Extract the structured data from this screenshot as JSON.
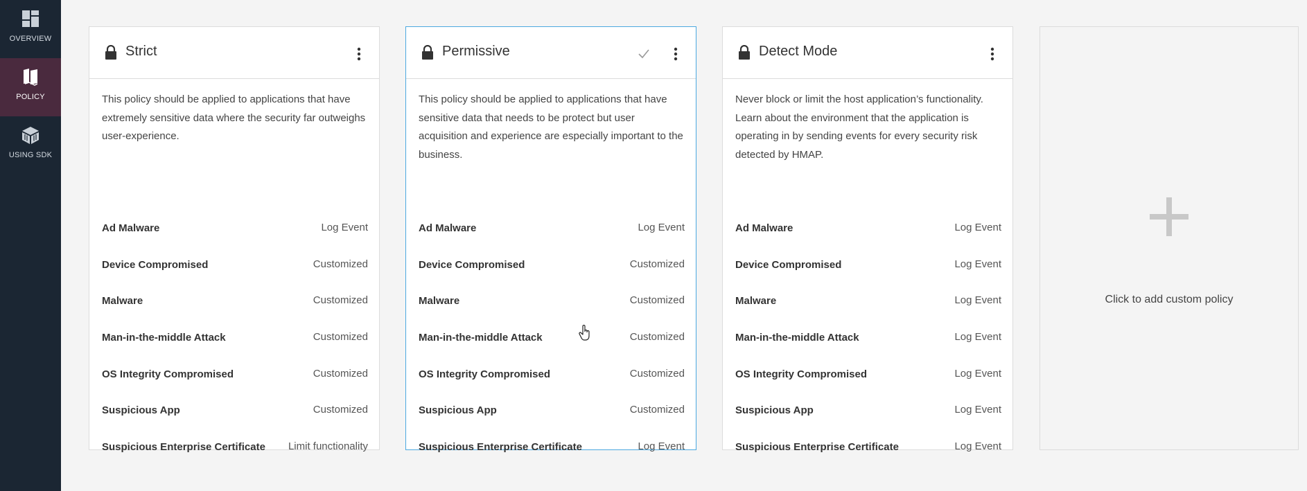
{
  "sidebar": {
    "items": [
      {
        "label": "OVERVIEW",
        "icon": "dashboard-icon"
      },
      {
        "label": "POLICY",
        "icon": "policy-book-icon",
        "active": true
      },
      {
        "label": "USING SDK",
        "icon": "sdk-cube-icon"
      }
    ]
  },
  "cards": [
    {
      "title": "Strict",
      "selected": false,
      "description": "This policy should be applied to applications that have extremely sensitive data where the security far outweighs user-experience.",
      "rules": [
        {
          "name": "Ad Malware",
          "value": "Log Event"
        },
        {
          "name": "Device Compromised",
          "value": "Customized"
        },
        {
          "name": "Malware",
          "value": "Customized"
        },
        {
          "name": "Man-in-the-middle Attack",
          "value": "Customized"
        },
        {
          "name": "OS Integrity Compromised",
          "value": "Customized"
        },
        {
          "name": "Suspicious App",
          "value": "Customized"
        },
        {
          "name": "Suspicious Enterprise Certificate",
          "value": "Limit functionality"
        }
      ]
    },
    {
      "title": "Permissive",
      "selected": true,
      "description": "This policy should be applied to applications that have sensitive data that needs to be protect but user acquisition and experience are especially important to the business.",
      "rules": [
        {
          "name": "Ad Malware",
          "value": "Log Event"
        },
        {
          "name": "Device Compromised",
          "value": "Customized"
        },
        {
          "name": "Malware",
          "value": "Customized"
        },
        {
          "name": "Man-in-the-middle Attack",
          "value": "Customized"
        },
        {
          "name": "OS Integrity Compromised",
          "value": "Customized"
        },
        {
          "name": "Suspicious App",
          "value": "Customized"
        },
        {
          "name": "Suspicious Enterprise Certificate",
          "value": "Log Event"
        }
      ]
    },
    {
      "title": "Detect Mode",
      "selected": false,
      "description": "Never block or limit the host application’s functionality. Learn about the environment that the application is operating in by sending events for every security risk detected by HMAP.",
      "rules": [
        {
          "name": "Ad Malware",
          "value": "Log Event"
        },
        {
          "name": "Device Compromised",
          "value": "Log Event"
        },
        {
          "name": "Malware",
          "value": "Log Event"
        },
        {
          "name": "Man-in-the-middle Attack",
          "value": "Log Event"
        },
        {
          "name": "OS Integrity Compromised",
          "value": "Log Event"
        },
        {
          "name": "Suspicious App",
          "value": "Log Event"
        },
        {
          "name": "Suspicious Enterprise Certificate",
          "value": "Log Event"
        }
      ]
    }
  ],
  "add_card": {
    "label": "Click to add custom policy",
    "icon": "plus-icon"
  },
  "colors": {
    "sidebar_bg": "#1b2633",
    "sidebar_active_bg": "#4a2a3e",
    "selected_border": "#4aa8e0",
    "page_bg": "#f4f4f4"
  }
}
